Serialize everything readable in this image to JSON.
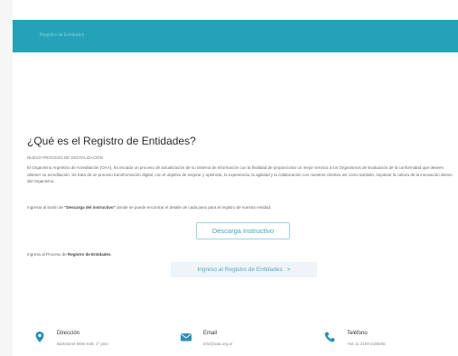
{
  "banner": {
    "breadcrumb": "Registro de Entidades"
  },
  "main": {
    "title": "¿Qué es el Registro de Entidades?",
    "kicker": "NUEVO PROCESO DE DIGITALIZACIÓN",
    "paragraph": "El Organismo Argentino de Acreditación (OAA), ha iniciado un proceso de actualización de su sistema de información con la finalidad de proporcionar un mejor servicio a los Organismos de Evaluación de la conformidad que deseen obtener su acreditación. Se trata de un proceso transformación digital, con el objetivo de mejorar y optimizar, la experiencia, la agilidad y la colaboración con nuestros clientes así como también, impulsar la cultura de la innovación dentro del Organismo.",
    "instructions_prefix": "Ingresar al botón de ",
    "instructions_bold": "\"Descarga del instructivo\"",
    "instructions_suffix": " donde se puede encontrar el detalle de cada paso para el registro de nuestra entidad.",
    "download_button": "Descarga Instructivo",
    "ingresa_prefix": "Ingresa al Proceso de ",
    "ingresa_bold": "Registro de Entidades",
    "ingresa_suffix": ".",
    "ingreso_button": "Ingreso al Registro de Entidades",
    "ingreso_chevron": ">"
  },
  "contact": {
    "address": {
      "label": "Dirección",
      "value": "Bartolomé Mitre 648, 1º piso",
      "icon": "location-pin-icon"
    },
    "email": {
      "label": "Email",
      "value": "info@oaa.org.ar",
      "icon": "envelope-icon"
    },
    "phone": {
      "label": "Teléfono",
      "value": "+54 11 2150-2155/56",
      "icon": "phone-icon"
    }
  },
  "colors": {
    "banner": "#26a2b8",
    "accent": "#3ba7c2",
    "icon": "#2a8fb5"
  }
}
